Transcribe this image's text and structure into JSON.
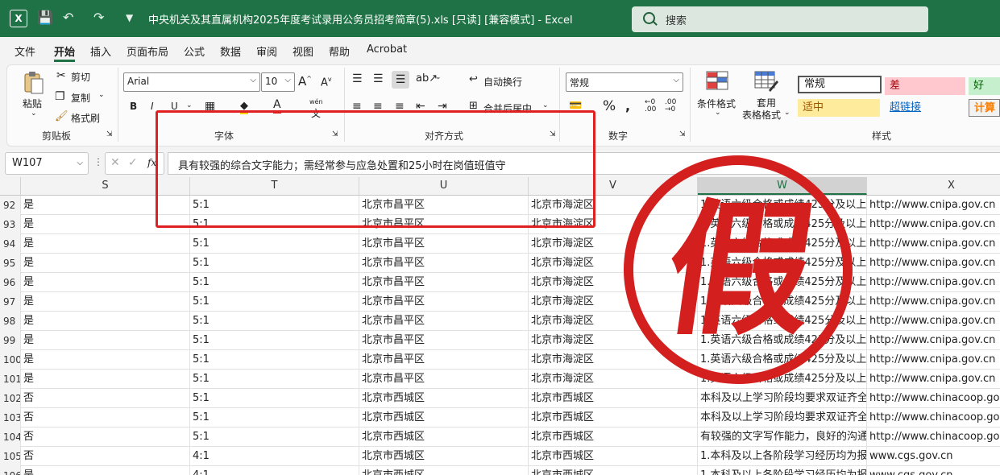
{
  "window": {
    "title": "中央机关及其直属机构2025年度考试录用公务员招考简章(5).xls  [只读]  [兼容模式]  -  Excel",
    "search_placeholder": "搜索"
  },
  "menu": [
    "文件",
    "开始",
    "插入",
    "页面布局",
    "公式",
    "数据",
    "审阅",
    "视图",
    "帮助",
    "Acrobat"
  ],
  "ribbon": {
    "clipboard": {
      "paste": "粘贴",
      "cut": "剪切",
      "copy": "复制",
      "format_painter": "格式刷",
      "label": "剪贴板"
    },
    "font": {
      "name": "Arial",
      "size": "10",
      "label": "字体",
      "bold": "B",
      "italic": "I",
      "underline": "U",
      "wen": "wén"
    },
    "alignment": {
      "wrap": "自动换行",
      "merge": "合并后居中",
      "label": "对齐方式"
    },
    "number": {
      "format": "常规",
      "label": "数字"
    },
    "styles": {
      "conditional": "条件格式",
      "table_line1": "套用",
      "table_line2": "表格格式",
      "normal": "常规",
      "bad": "差",
      "good": "好",
      "neutral": "适中",
      "hyperlink": "超链接",
      "calc": "计算",
      "label": "样式"
    }
  },
  "formula_bar": {
    "name_box": "W107",
    "fx": "fx",
    "content": "具有较强的综合文字能力；需经常参与应急处置和25小时在岗值班值守"
  },
  "columns": [
    "S",
    "T",
    "U",
    "V",
    "W",
    "X"
  ],
  "selected_column": "W",
  "rows": [
    {
      "n": "92",
      "s": "是",
      "t": "5:1",
      "u": "北京市昌平区",
      "v": "北京市海淀区",
      "w": "1.英语六级合格或成绩425分及以上,",
      "x": "http://www.cnipa.gov.cn"
    },
    {
      "n": "93",
      "s": "是",
      "t": "5:1",
      "u": "北京市昌平区",
      "v": "北京市海淀区",
      "w": "1.英语六级合格或成绩425分及以上,",
      "x": "http://www.cnipa.gov.cn"
    },
    {
      "n": "94",
      "s": "是",
      "t": "5:1",
      "u": "北京市昌平区",
      "v": "北京市海淀区",
      "w": "1.英语六级合格或成绩425分及以上,",
      "x": "http://www.cnipa.gov.cn"
    },
    {
      "n": "95",
      "s": "是",
      "t": "5:1",
      "u": "北京市昌平区",
      "v": "北京市海淀区",
      "w": "1.英语六级合格或成绩425分及以上,",
      "x": "http://www.cnipa.gov.cn"
    },
    {
      "n": "96",
      "s": "是",
      "t": "5:1",
      "u": "北京市昌平区",
      "v": "北京市海淀区",
      "w": "1.英语六级合格或成绩425分及以上,",
      "x": "http://www.cnipa.gov.cn"
    },
    {
      "n": "97",
      "s": "是",
      "t": "5:1",
      "u": "北京市昌平区",
      "v": "北京市海淀区",
      "w": "1.英语六级合格或成绩425分及以上,",
      "x": "http://www.cnipa.gov.cn"
    },
    {
      "n": "98",
      "s": "是",
      "t": "5:1",
      "u": "北京市昌平区",
      "v": "北京市海淀区",
      "w": "1.英语六级合格或成绩425分及以上,",
      "x": "http://www.cnipa.gov.cn"
    },
    {
      "n": "99",
      "s": "是",
      "t": "5:1",
      "u": "北京市昌平区",
      "v": "北京市海淀区",
      "w": "1.英语六级合格或成绩425分及以上,",
      "x": "http://www.cnipa.gov.cn"
    },
    {
      "n": "100",
      "s": "是",
      "t": "5:1",
      "u": "北京市昌平区",
      "v": "北京市海淀区",
      "w": "1.英语六级合格或成绩425分及以上,",
      "x": "http://www.cnipa.gov.cn"
    },
    {
      "n": "101",
      "s": "是",
      "t": "5:1",
      "u": "北京市昌平区",
      "v": "北京市海淀区",
      "w": "1.英语六级合格或成绩425分及以上,",
      "x": "http://www.cnipa.gov.cn"
    },
    {
      "n": "102",
      "s": "否",
      "t": "5:1",
      "u": "北京市西城区",
      "v": "北京市西城区",
      "w": "本科及以上学习阶段均要求双证齐全",
      "x": "http://www.chinacoop.gov.cn"
    },
    {
      "n": "103",
      "s": "否",
      "t": "5:1",
      "u": "北京市西城区",
      "v": "北京市西城区",
      "w": "本科及以上学习阶段均要求双证齐全",
      "x": "http://www.chinacoop.gov.cn"
    },
    {
      "n": "104",
      "s": "否",
      "t": "5:1",
      "u": "北京市西城区",
      "v": "北京市西城区",
      "w": "有较强的文字写作能力，良好的沟通",
      "x": "http://www.chinacoop.gov.cn"
    },
    {
      "n": "105",
      "s": "否",
      "t": "4:1",
      "u": "北京市西城区",
      "v": "北京市西城区",
      "w": "1.本科及以上各阶段学习经历均为报",
      "x": "www.cgs.gov.cn"
    },
    {
      "n": "106",
      "s": "是",
      "t": "4:1",
      "u": "北京市西城区",
      "v": "北京市西城区",
      "w": "1.本科及以上各阶段学习经历均为报",
      "x": "www.cgs.gov.cn"
    }
  ],
  "stamp": {
    "text": "假",
    "color": "#d41f1f"
  },
  "colors": {
    "excel_green": "#1f7245",
    "highlight_red": "#e02020"
  }
}
